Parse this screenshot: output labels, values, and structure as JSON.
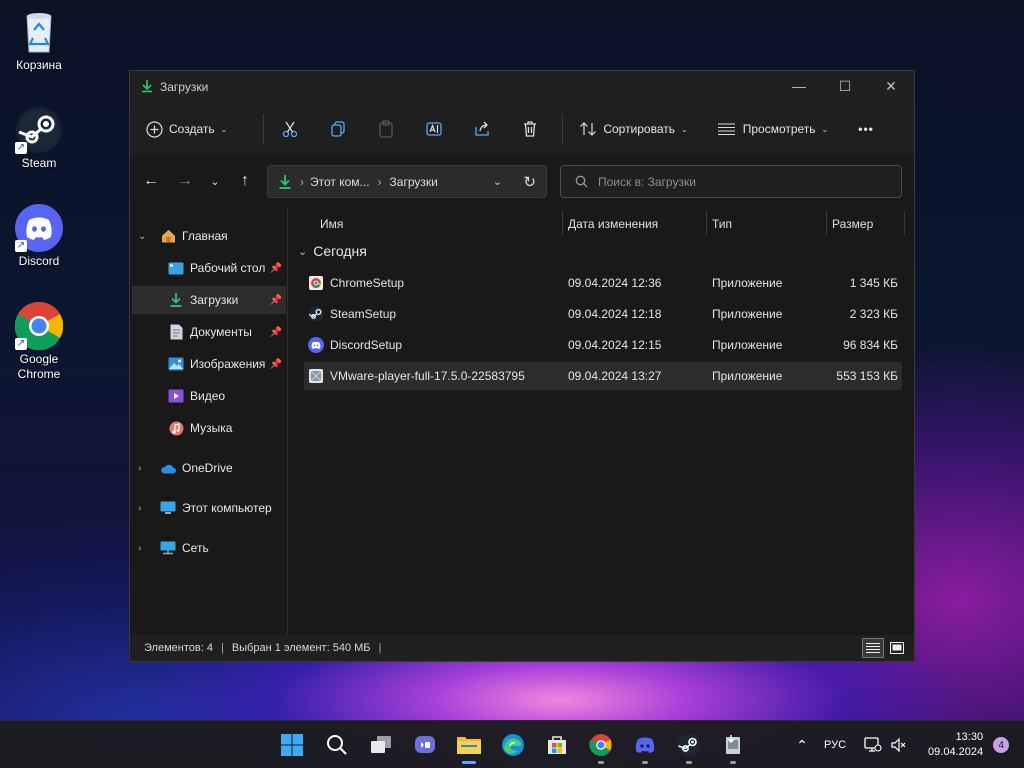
{
  "desktop": {
    "icons": [
      {
        "label": "Корзина",
        "icon": "recycle-bin-icon"
      },
      {
        "label": "Steam",
        "icon": "steam-icon"
      },
      {
        "label": "Discord",
        "icon": "discord-icon"
      },
      {
        "label": "Google Chrome",
        "icon": "chrome-icon"
      }
    ]
  },
  "window": {
    "title": "Загрузки",
    "controls": {
      "minimize": "—",
      "maximize": "☐",
      "close": "✕"
    },
    "toolbar": {
      "new_label": "Создать",
      "sort_label": "Сортировать",
      "view_label": "Просмотреть",
      "more_label": "•••"
    },
    "nav": {
      "address_parts": [
        "Этот ком...",
        "Загрузки"
      ],
      "address_sep": "›",
      "search_placeholder": "Поиск в: Загрузки"
    },
    "sidebar": {
      "home": "Главная",
      "items": [
        {
          "label": "Рабочий стол",
          "pinned": true
        },
        {
          "label": "Загрузки",
          "pinned": true,
          "selected": true
        },
        {
          "label": "Документы",
          "pinned": true
        },
        {
          "label": "Изображения",
          "pinned": true
        },
        {
          "label": "Видео",
          "pinned": false
        },
        {
          "label": "Музыка",
          "pinned": false
        }
      ],
      "onedrive": "OneDrive",
      "this_pc": "Этот компьютер",
      "network": "Сеть"
    },
    "columns": {
      "name": "Имя",
      "date": "Дата изменения",
      "type": "Тип",
      "size": "Размер"
    },
    "group_label": "Сегодня",
    "files": [
      {
        "name": "ChromeSetup",
        "date": "09.04.2024 12:36",
        "type": "Приложение",
        "size": "1 345 КБ"
      },
      {
        "name": "SteamSetup",
        "date": "09.04.2024 12:18",
        "type": "Приложение",
        "size": "2 323 КБ"
      },
      {
        "name": "DiscordSetup",
        "date": "09.04.2024 12:15",
        "type": "Приложение",
        "size": "96 834 КБ"
      },
      {
        "name": "VMware-player-full-17.5.0-22583795",
        "date": "09.04.2024 13:27",
        "type": "Приложение",
        "size": "553 153 КБ"
      }
    ],
    "status": {
      "count": "Элементов: 4",
      "selected": "Выбран 1 элемент: 540 МБ"
    }
  },
  "taskbar": {
    "lang": "РУС",
    "time": "13:30",
    "date": "09.04.2024",
    "notifications": "4",
    "colors": {
      "accent": "#0a84ff",
      "badge": "#c8a0e8"
    }
  }
}
